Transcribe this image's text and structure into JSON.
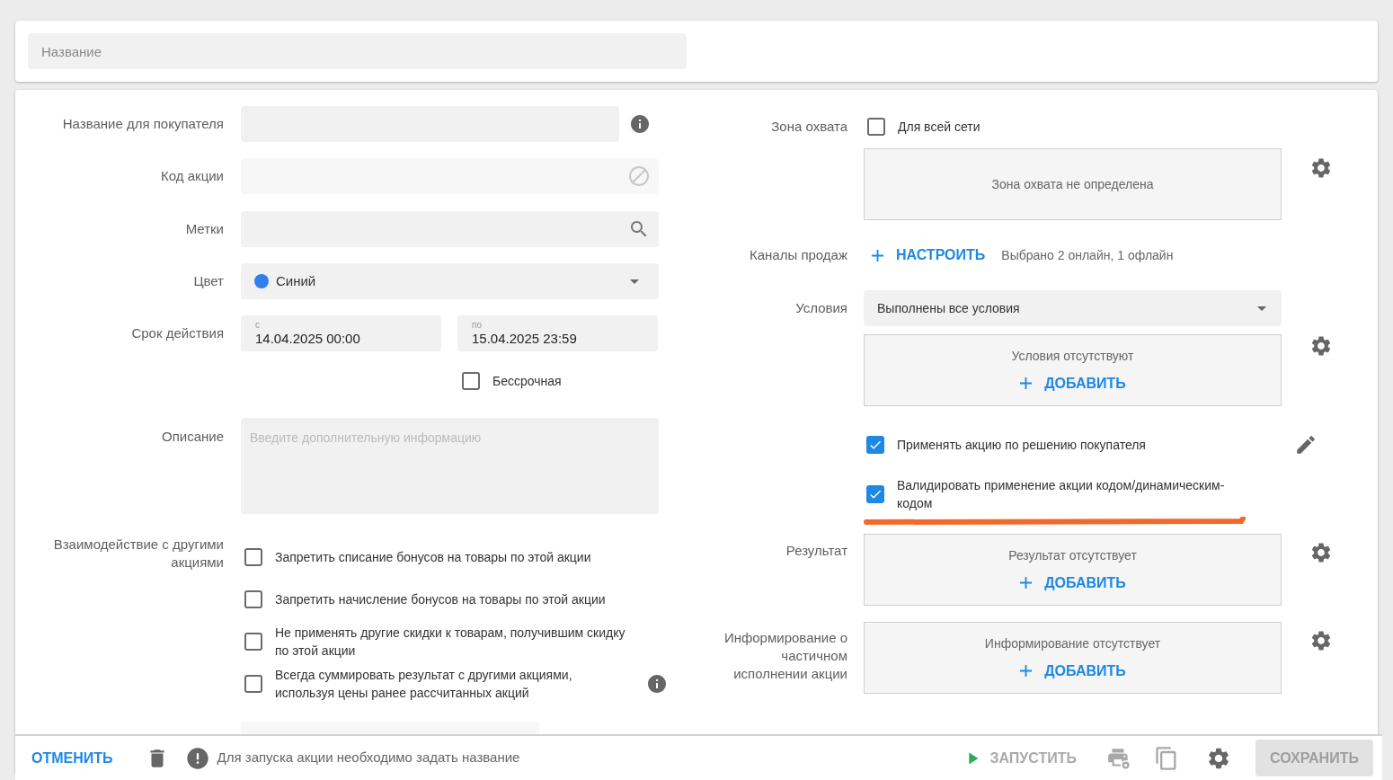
{
  "title_field": {
    "placeholder": "Название"
  },
  "customer_name": {
    "label": "Название для покупателя"
  },
  "promo_code": {
    "label": "Код акции",
    "disabled": true
  },
  "tags": {
    "label": "Метки"
  },
  "color": {
    "label": "Цвет",
    "value": "Синий",
    "color": "#2f80ed"
  },
  "period": {
    "label": "Срок действия",
    "from": {
      "label": "с",
      "value": "14.04.2025 00:00"
    },
    "to": {
      "label": "по",
      "value": "15.04.2025 23:59"
    },
    "unlimited": {
      "label": "Бессрочная",
      "checked": false
    }
  },
  "description": {
    "label": "Описание",
    "placeholder": "Введите дополнительную информацию"
  },
  "interaction": {
    "label": "Взаимодействие с другими акциями",
    "options": [
      {
        "label": "Запретить списание бонусов на товары по этой акции",
        "checked": false,
        "info": false
      },
      {
        "label": "Запретить начисление бонусов на товары по этой акции",
        "checked": false,
        "info": false
      },
      {
        "label": "Не применять другие скидки к товарам, получившим скидку по этой акции",
        "checked": false,
        "info": false
      },
      {
        "label": "Всегда суммировать результат с другими акциями, используя цены ранее рассчитанных акций",
        "checked": false,
        "info": true
      }
    ]
  },
  "coverage": {
    "label": "Зона охвата",
    "all_network": {
      "label": "Для всей сети",
      "checked": false
    },
    "empty_text": "Зона охвата не определена"
  },
  "sales_channels": {
    "label": "Каналы продаж",
    "action": "НАСТРОИТЬ",
    "summary": "Выбрано 2 онлайн, 1 офлайн"
  },
  "conditions": {
    "label": "Условия",
    "mode": "Выполнены все условия",
    "empty_text": "Условия отсутствуют",
    "action": "ДОБАВИТЬ"
  },
  "options": [
    {
      "label": "Применять акцию по решению покупателя",
      "checked": true,
      "editable": true,
      "underlined": false
    },
    {
      "label": "Валидировать применение акции кодом/динамическим-кодом",
      "checked": true,
      "editable": false,
      "underlined": true
    }
  ],
  "result": {
    "label": "Результат",
    "empty_text": "Результат отсутствует",
    "action": "ДОБАВИТЬ"
  },
  "notification": {
    "label": "Информирование о частичном исполнении акции",
    "empty_text": "Информирование отсутствует",
    "action": "ДОБАВИТЬ"
  },
  "footer": {
    "cancel": "ОТМЕНИТЬ",
    "message": "Для запуска акции необходимо задать название",
    "launch": {
      "label": "ЗАПУСТИТЬ",
      "disabled": true
    },
    "save": {
      "label": "СОХРАНИТЬ",
      "disabled": true
    }
  }
}
